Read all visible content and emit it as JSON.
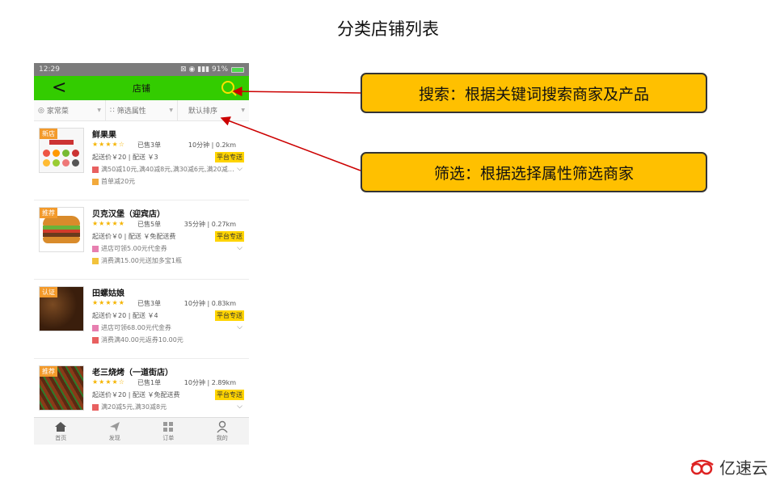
{
  "page_title": "分类店铺列表",
  "status_bar": {
    "time": "12:29",
    "icons": "⊠ ◉ ▮▮▮ 91%"
  },
  "navbar": {
    "back_icon": "<",
    "title": "店铺"
  },
  "filters": [
    {
      "label": "家常菜",
      "icon": "location-icon"
    },
    {
      "label": "筛选属性",
      "icon": "grid-icon"
    },
    {
      "label": "默认排序",
      "icon": ""
    }
  ],
  "shops": [
    {
      "tag": "新店",
      "name": "鲜果果",
      "stars": "★★★★☆",
      "sold": "已售3单",
      "time": "10分钟 | 0.2km",
      "fee": "起送价￥20 | 配送 ￥3",
      "delivery": "平台专送",
      "promos": [
        {
          "color": "#e86060",
          "text": "满50减10元,满40减8元,满30减6元,满20减…"
        },
        {
          "color": "#f2a93b",
          "text": "首单减20元"
        }
      ]
    },
    {
      "tag": "推荐",
      "name": "贝克汉堡（迎宾店）",
      "stars": "★★★★★",
      "sold": "已售5单",
      "time": "35分钟 | 0.27km",
      "fee": "起送价￥0 | 配送 ￥免配送费",
      "delivery": "平台专送",
      "promos": [
        {
          "color": "#e77fb0",
          "text": "进店可领5.00元代金券"
        },
        {
          "color": "#f2c23b",
          "text": "消费满15.00元送加多宝1瓶"
        }
      ]
    },
    {
      "tag": "认证",
      "name": "田螺姑娘",
      "stars": "★★★★★",
      "sold": "已售3单",
      "time": "10分钟 | 0.83km",
      "fee": "起送价￥20 | 配送 ￥4",
      "delivery": "平台专送",
      "promos": [
        {
          "color": "#e77fb0",
          "text": "进店可领68.00元代金券"
        },
        {
          "color": "#e86060",
          "text": "消费满40.00元返券10.00元"
        }
      ]
    },
    {
      "tag": "推荐",
      "name": "老三烧烤（一道街店）",
      "stars": "★★★★☆",
      "sold": "已售1单",
      "time": "10分钟 | 2.89km",
      "fee": "起送价￥20 | 配送 ￥免配送费",
      "delivery": "平台专送",
      "promos": [
        {
          "color": "#e86060",
          "text": "满20减5元,满30减8元"
        }
      ]
    }
  ],
  "tabs": [
    {
      "label": "首页",
      "icon": "home-icon"
    },
    {
      "label": "发现",
      "icon": "send-icon"
    },
    {
      "label": "订单",
      "icon": "orders-icon"
    },
    {
      "label": "我的",
      "icon": "user-icon"
    }
  ],
  "callouts": {
    "search": "搜索：根据关键词搜索商家及产品",
    "filter": "筛选：根据选择属性筛选商家"
  },
  "logo_text": "亿速云",
  "colors": {
    "accent_green": "#33cc00",
    "callout_yellow": "#ffc000",
    "arrow_red": "#cc0000"
  }
}
